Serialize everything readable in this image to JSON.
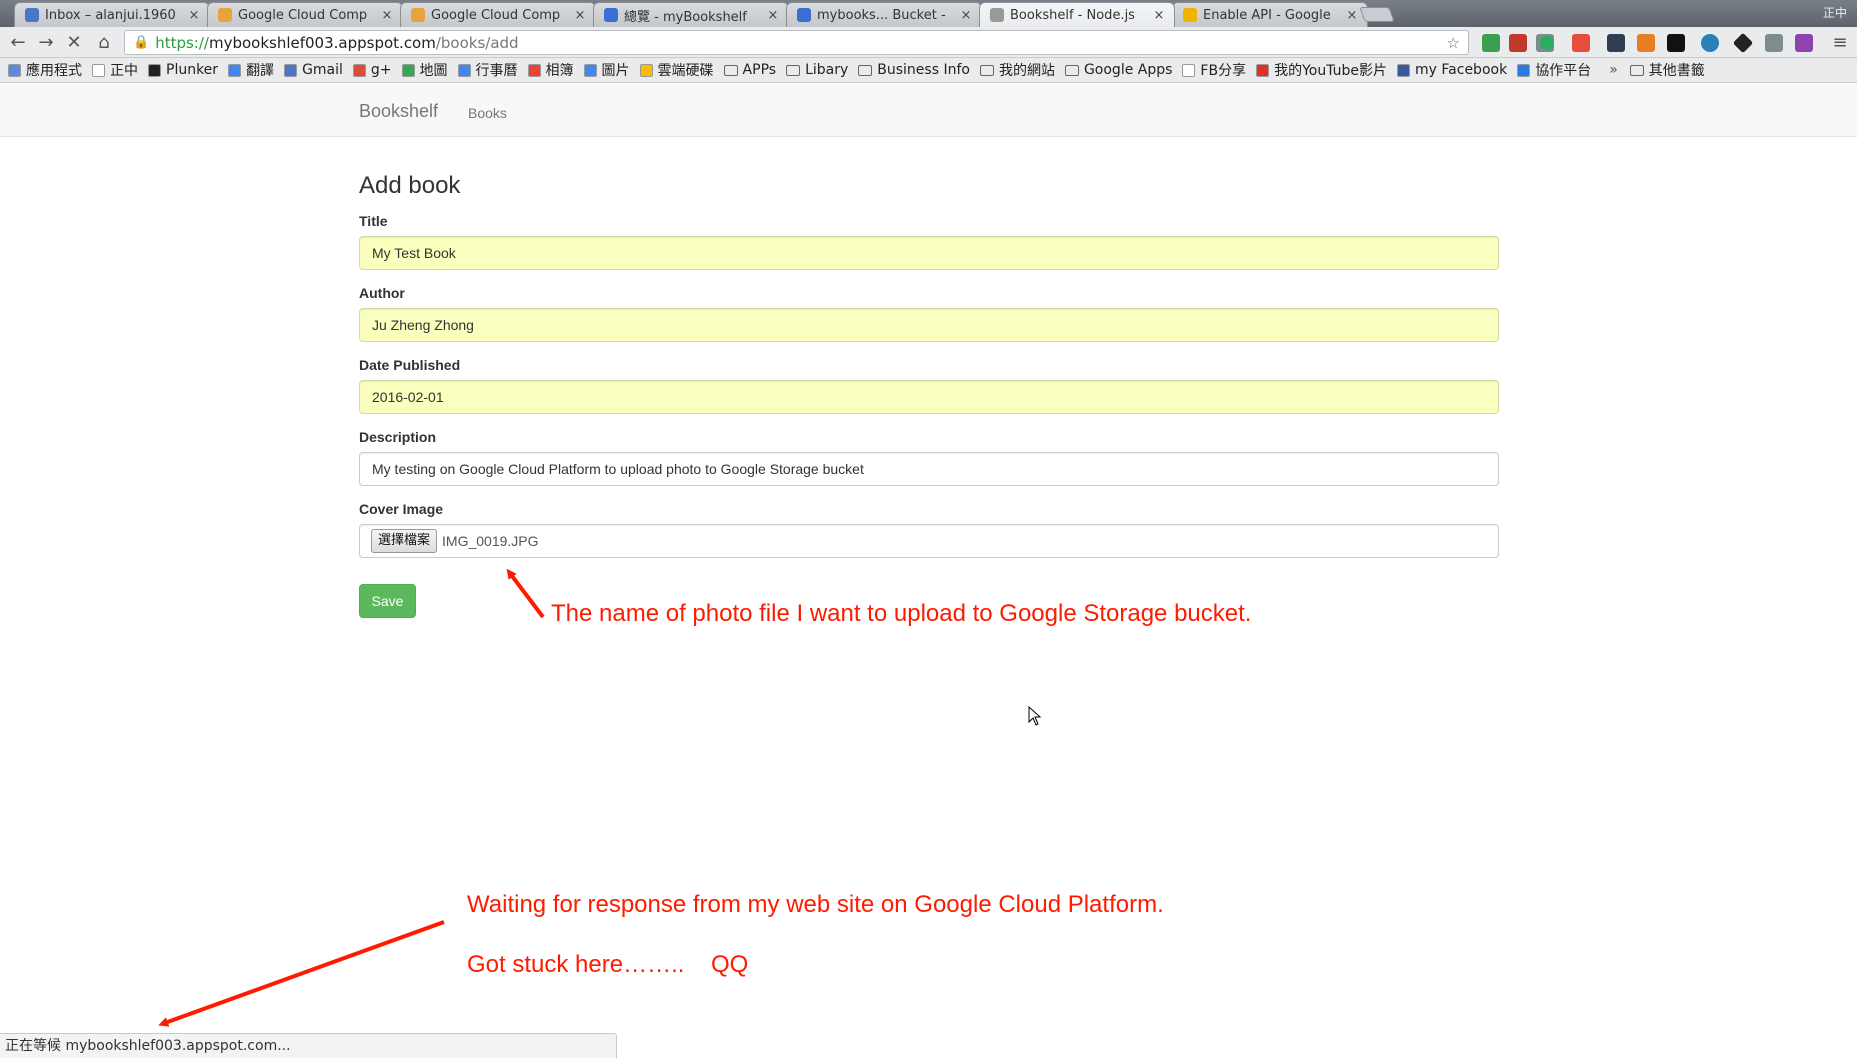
{
  "browser": {
    "tabs": [
      {
        "title": "Inbox – alanjui.1960",
        "favicon_color": "#4a77c8"
      },
      {
        "title": "Google Cloud Comp",
        "favicon_color": "#e8a33a"
      },
      {
        "title": "Google Cloud Comp",
        "favicon_color": "#e8a33a"
      },
      {
        "title": "總覽 - myBookshelf",
        "favicon_color": "#3b6fd6"
      },
      {
        "title": "mybooks... Bucket -",
        "favicon_color": "#3b6fd6"
      },
      {
        "title": "Bookshelf - Node.js",
        "favicon_color": "#999999"
      },
      {
        "title": "Enable API - Google",
        "favicon_color": "#f0b400"
      }
    ],
    "active_tab_index": 5,
    "tab_close_glyph": "×",
    "window_caption": "正中",
    "url": {
      "scheme": "https://",
      "host": "mybookshlef003.appspot.com",
      "path": "/books/add"
    },
    "bookmarks": [
      {
        "label": "應用程式",
        "icon_color": "#5a8be0",
        "kind": "link"
      },
      {
        "label": "正中",
        "icon_color": "#ffffff",
        "kind": "link"
      },
      {
        "label": "Plunker",
        "icon_color": "#222222",
        "kind": "link"
      },
      {
        "label": "翻譯",
        "icon_color": "#4285f4",
        "kind": "link"
      },
      {
        "label": "Gmail",
        "icon_color": "#4a77c8",
        "kind": "link"
      },
      {
        "label": "g+",
        "icon_color": "#dd4b39",
        "kind": "link"
      },
      {
        "label": "地圖",
        "icon_color": "#34a853",
        "kind": "link"
      },
      {
        "label": "行事曆",
        "icon_color": "#4285f4",
        "kind": "link"
      },
      {
        "label": "相簿",
        "icon_color": "#ea4335",
        "kind": "link"
      },
      {
        "label": "圖片",
        "icon_color": "#4285f4",
        "kind": "link"
      },
      {
        "label": "雲端硬碟",
        "icon_color": "#fbbc05",
        "kind": "link"
      },
      {
        "label": "APPs",
        "kind": "folder"
      },
      {
        "label": "Libary",
        "kind": "folder"
      },
      {
        "label": "Business Info",
        "kind": "folder"
      },
      {
        "label": "我的網站",
        "kind": "folder"
      },
      {
        "label": "Google Apps",
        "kind": "folder"
      },
      {
        "label": "FB分享",
        "icon_color": "#ffffff",
        "kind": "link"
      },
      {
        "label": "我的YouTube影片",
        "icon_color": "#e52d27",
        "kind": "link"
      },
      {
        "label": "my Facebook",
        "icon_color": "#3b5998",
        "kind": "link"
      },
      {
        "label": "協作平台",
        "icon_color": "#2c7be5",
        "kind": "link"
      }
    ],
    "bookmarks_more": "»",
    "bookmarks_other": "其他書籤",
    "status_text": "正在等候 mybookshlef003.appspot.com..."
  },
  "page": {
    "brand": "Bookshelf",
    "nav_books": "Books",
    "heading": "Add book",
    "fields": {
      "title": {
        "label": "Title",
        "value": "My Test Book"
      },
      "author": {
        "label": "Author",
        "value": "Ju Zheng Zhong"
      },
      "date": {
        "label": "Date Published",
        "value": "2016-02-01"
      },
      "description": {
        "label": "Description",
        "value": "My testing on Google Cloud Platform to upload photo to Google Storage bucket"
      },
      "cover": {
        "label": "Cover Image",
        "button": "選擇檔案",
        "file_name": "IMG_0019.JPG"
      }
    },
    "save_label": "Save"
  },
  "annotations": {
    "file_note": "The name of photo file I want to upload to Google Storage bucket.",
    "waiting_note": "Waiting for response from my web site on Google Cloud Platform.",
    "stuck_note": "Got stuck here……..",
    "qq": "QQ",
    "color": "#ff1a00"
  }
}
